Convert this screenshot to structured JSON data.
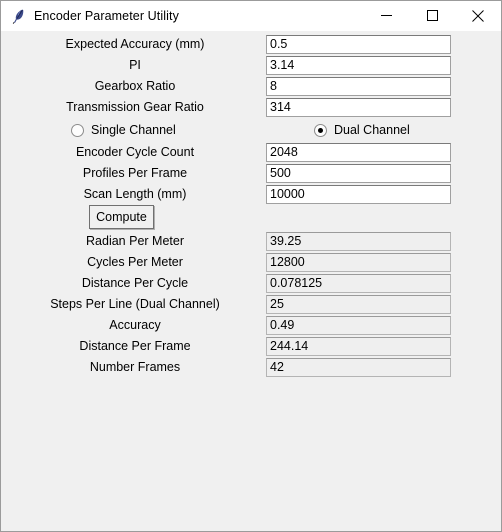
{
  "window": {
    "title": "Encoder Parameter Utility",
    "icon": "feather-quill-icon",
    "controls": {
      "minimize": "Minimize",
      "maximize": "Maximize",
      "close": "Close"
    },
    "background_color": "#f0f0f0",
    "titlebar_color": "#ffffff",
    "border_color": "#9b9b9b"
  },
  "inputs": [
    {
      "label": "Expected Accuracy (mm)",
      "value": "0.5"
    },
    {
      "label": "PI",
      "value": "3.14"
    },
    {
      "label": "Gearbox Ratio",
      "value": "8"
    },
    {
      "label": "Transmission Gear Ratio",
      "value": "314"
    }
  ],
  "channel": {
    "options": [
      {
        "label": "Single Channel",
        "selected": false
      },
      {
        "label": "Dual Channel",
        "selected": true
      }
    ]
  },
  "inputs2": [
    {
      "label": "Encoder Cycle Count",
      "value": "2048"
    },
    {
      "label": "Profiles Per Frame",
      "value": "500"
    },
    {
      "label": "Scan Length (mm)",
      "value": "10000"
    }
  ],
  "compute_button": {
    "label": "Compute"
  },
  "results": [
    {
      "label": "Radian Per Meter",
      "value": "39.25"
    },
    {
      "label": "Cycles Per Meter",
      "value": "12800"
    },
    {
      "label": "Distance Per Cycle",
      "value": "0.078125"
    },
    {
      "label": "Steps Per Line (Dual Channel)",
      "value": "25"
    },
    {
      "label": "Accuracy",
      "value": "0.49"
    },
    {
      "label": "Distance Per Frame",
      "value": "244.14"
    },
    {
      "label": "Number Frames",
      "value": "42"
    }
  ]
}
